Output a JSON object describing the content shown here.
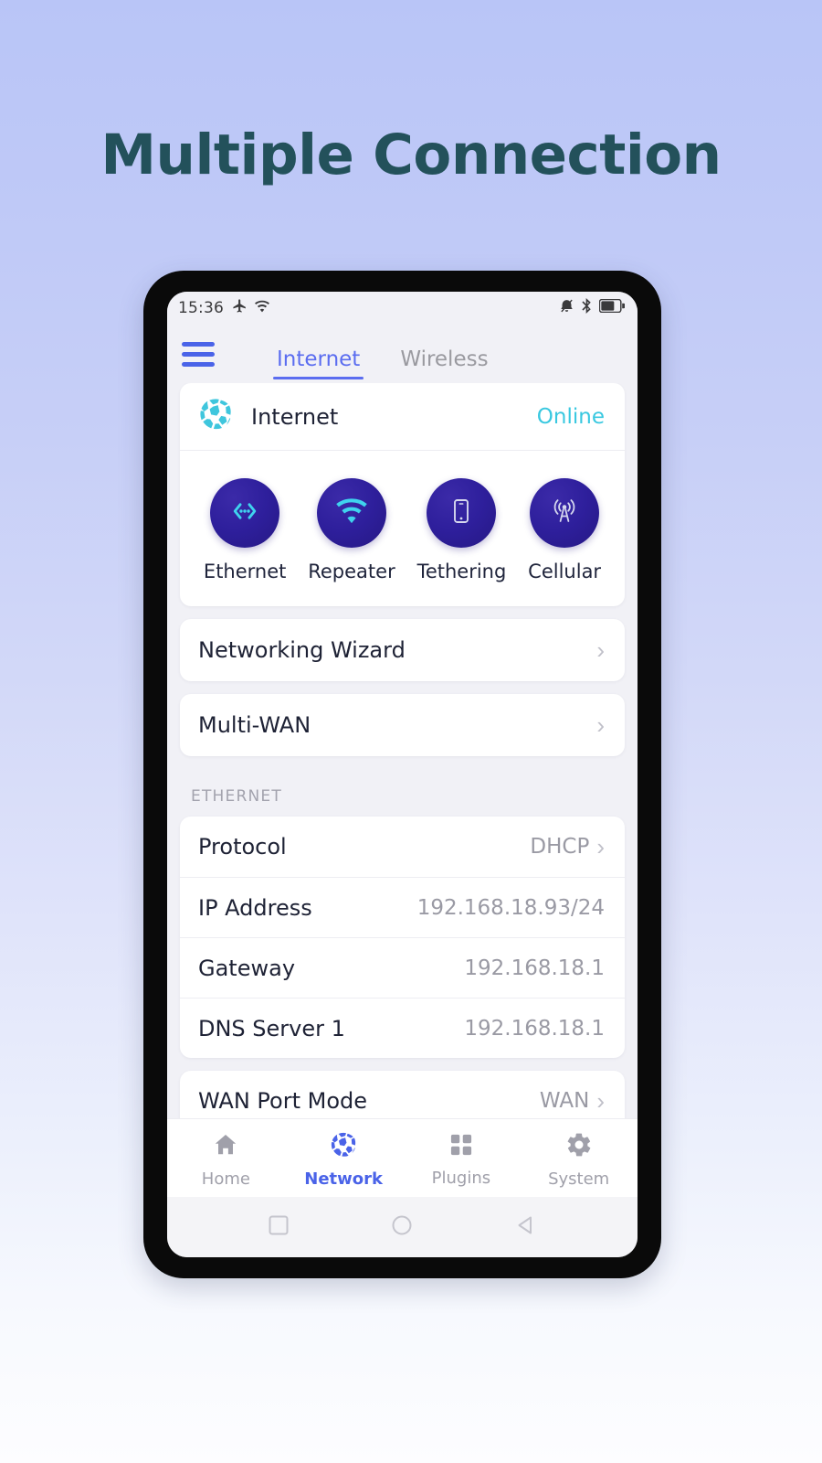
{
  "headline": "Multiple Connection",
  "colors": {
    "accent_blue": "#4a63e8",
    "tab_blue": "#5b6df0",
    "cyan": "#39c8e0",
    "tile_indigo": "#2e1f9c",
    "headline_teal": "#23515b",
    "muted_gray": "#9a9aa4",
    "app_bg": "#f1f1f6"
  },
  "statusbar": {
    "time": "15:36",
    "left_icons": [
      "airplane-icon",
      "wifi-icon"
    ],
    "right_icons": [
      "mute-icon",
      "bluetooth-icon",
      "battery-icon"
    ]
  },
  "appbar": {
    "menu_icon": "hamburger-icon",
    "tabs": [
      {
        "label": "Internet",
        "active": true
      },
      {
        "label": "Wireless",
        "active": false
      }
    ]
  },
  "internet_card": {
    "icon": "globe-icon",
    "title": "Internet",
    "status": "Online",
    "connections": [
      {
        "label": "Ethernet",
        "icon": "ethernet-icon"
      },
      {
        "label": "Repeater",
        "icon": "wifi-icon"
      },
      {
        "label": "Tethering",
        "icon": "phone-icon"
      },
      {
        "label": "Cellular",
        "icon": "cell-tower-icon"
      }
    ]
  },
  "nav_rows": [
    {
      "label": "Networking Wizard",
      "value": "",
      "chevron": "›"
    },
    {
      "label": "Multi-WAN",
      "value": "",
      "chevron": "›"
    }
  ],
  "ethernet_section": {
    "header": "ETHERNET",
    "protocol": {
      "label": "Protocol",
      "value": "DHCP",
      "chevron": "›"
    },
    "rows": [
      {
        "label": "IP Address",
        "value": "192.168.18.93/24"
      },
      {
        "label": "Gateway",
        "value": "192.168.18.1"
      },
      {
        "label": "DNS Server 1",
        "value": "192.168.18.1"
      }
    ],
    "wan_port_mode": {
      "label": "WAN Port Mode",
      "value": "WAN",
      "chevron": "›"
    }
  },
  "tabbar": [
    {
      "label": "Home",
      "icon": "home-icon",
      "active": false
    },
    {
      "label": "Network",
      "icon": "globe-icon",
      "active": true
    },
    {
      "label": "Plugins",
      "icon": "grid-icon",
      "active": false
    },
    {
      "label": "System",
      "icon": "gear-icon",
      "active": false
    }
  ],
  "androidnav": [
    {
      "icon": "recents-square-icon"
    },
    {
      "icon": "home-circle-icon"
    },
    {
      "icon": "back-triangle-icon"
    }
  ]
}
